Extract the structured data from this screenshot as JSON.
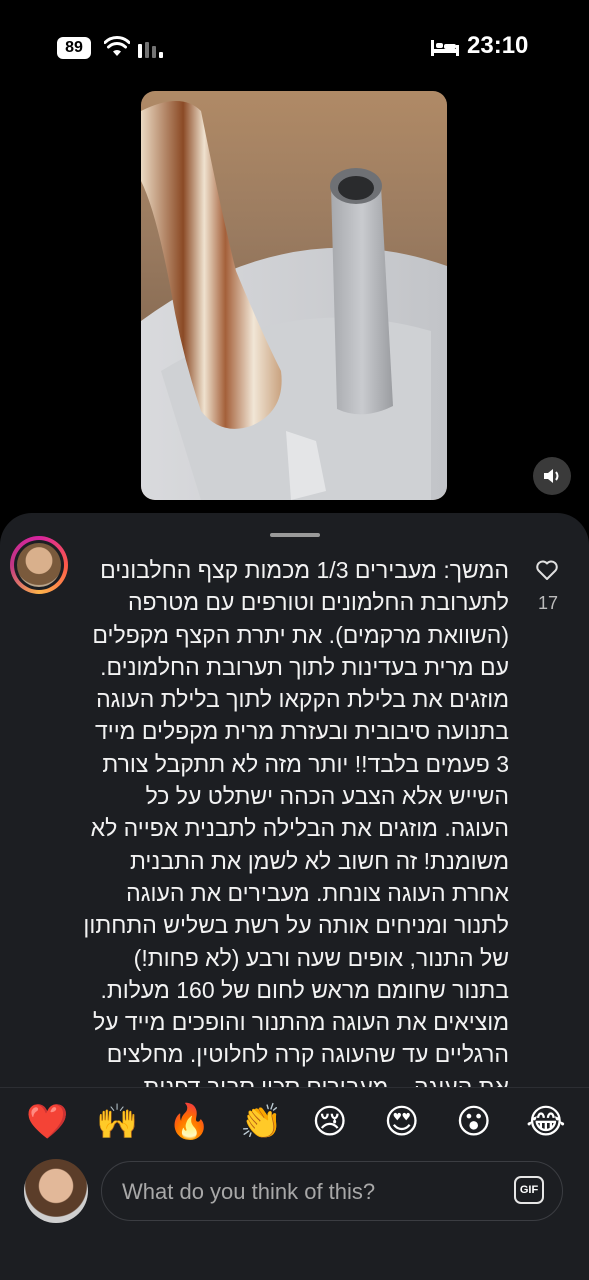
{
  "status_bar": {
    "battery": "89",
    "time": "23:10"
  },
  "comment": {
    "text": "המשך: מעבירים 1/3 מכמות קצף החלבונים\nלתערובת החלמונים וטורפים עם מטרפה\n(השוואת מרקמים). את יתרת הקצף מקפלים\nעם מרית בעדינות לתוך תערובת החלמונים.\nמוזגים את בלילת הקקאו לתוך בלילת העוגה\nבתנועה סיבובית ובעזרת מרית מקפלים מייד\n3 פעמים בלבד!! יותר מזה לא תתקבל צורת\nהשייש אלא הצבע הכהה ישתלט על כל\nהעוגה. מוזגים את הבלילה לתבנית אפייה לא\nמשומנת! זה חשוב לא לשמן את התבנית\nאחרת העוגה צונחת. מעבירים את העוגה\nלתנור ומניחים אותה על רשת בשליש התחתון\nשל התנור, אופים שעה ורבע (לא פחות!)\nבתנור שחומם מראש לחום של 160 מעלות.\nמוציאים את העוגה מהתנור והופכים מייד על\nהרגליים עד שהעוגה קרה לחלוטין. מחלצים\nאת העוגה – מעבירים סכין סביב דפנות\nהתבנית, מכניסים סכין או מרית מתחת לבסיס\nהעוגה כדי לשחרר אותה מהתבנית והופכים",
    "likes": "17"
  },
  "reactions": [
    "❤️",
    "🙌",
    "🔥",
    "👏",
    "😢",
    "😍",
    "😮",
    "😂"
  ],
  "composer": {
    "placeholder": "What do you think of this?",
    "gif_label": "GIF"
  }
}
